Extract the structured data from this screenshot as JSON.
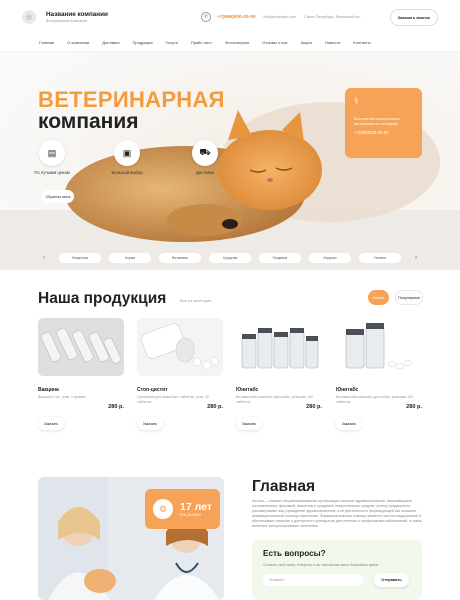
{
  "header": {
    "company_name": "Название компании",
    "company_sub": "Ветеринарная Компания",
    "phone": "+7(999)000-00-00",
    "email": "info@example.com",
    "address": "Санкт-Петербург, Ленинский пр.",
    "call_button": "Заказать звонок"
  },
  "nav": [
    "Главная",
    "О компании",
    "Доставка",
    "Продукция",
    "Услуги",
    "Прайс-лист",
    "Фотогалерея",
    "Отзывы о нас",
    "Акции",
    "Новости",
    "Контакты"
  ],
  "hero": {
    "title_line1": "ВЕТЕРИНАРНАЯ",
    "title_line2": "компания",
    "features": [
      {
        "icon": "wallet-icon",
        "label": "По лучшим ценам"
      },
      {
        "icon": "box-icon",
        "label": "Большой выбор"
      },
      {
        "icon": "truck-icon",
        "label": "Доставка"
      }
    ],
    "cta_button": "Обратная связь",
    "promo_text": "Бесплатная консультация ветеринара по телефону",
    "promo_phone": "+7(999)000-00-00",
    "categories": [
      "Лекарства",
      "Корма",
      "Витамины",
      "Средства",
      "Пищевые",
      "Игрушки",
      "Гигиена"
    ]
  },
  "products": {
    "title": "Наша продукция",
    "link": "Все из категории",
    "toggle_new": "Новые",
    "toggle_popular": "Популярные",
    "items": [
      {
        "name": "Вакцина",
        "desc": "Вакцина 1 мл, упак. 1 флакон",
        "price": "280 р.",
        "button": "Заказать"
      },
      {
        "name": "Стоп-цистит",
        "desc": "Суспензия для животных, таблетки, упак. 30 таблеток",
        "price": "280 р.",
        "button": "Заказать"
      },
      {
        "name": "Юнитабс",
        "desc": "Витаминный комплекс для собак, упаковка 100 таблеток",
        "price": "280 р.",
        "button": "Заказать"
      },
      {
        "name": "Юнитабс",
        "desc": "Витаминный комплекс для собак, упаковка 100 таблеток",
        "price": "280 р.",
        "button": "Заказать"
      }
    ]
  },
  "about": {
    "years": "17 лет",
    "years_sub": "На рынке",
    "title": "Главная",
    "text": "Аптека — первая специализированная организация системы здравоохранения, занимающаяся изготовлением, фасовкой, анализом и продажей лекарственных средств. Аптеку традиционно рассматривают как учреждение здравоохранения, а её деятельность формирующей как оказание фармацевтической помощи населению. Фармацевтическая помощь является частью медицинской и обеспечивает наличие и доступность препаратов для лечения и профилактики заболеваний, а также включает консультирование населения.",
    "question_title": "Есть вопросы?",
    "question_sub": "Оставьте свой номер телефона, и мы перезвоним вам в ближайшее время",
    "phone_placeholder": "Телефон*",
    "send_button": "Отправить"
  }
}
